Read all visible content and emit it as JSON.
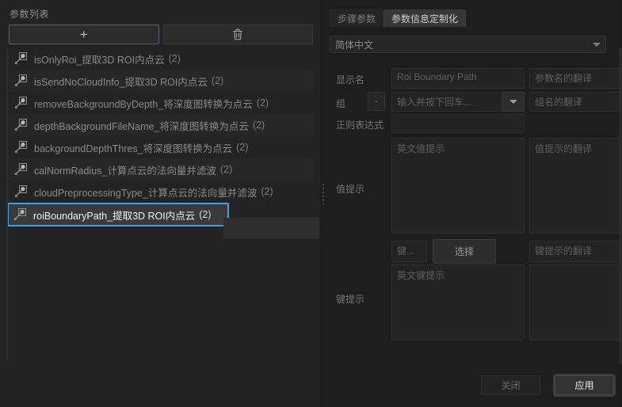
{
  "left_panel": {
    "title": "参数列表",
    "toolbar": {
      "add_label": "+",
      "add_icon": "plus-icon",
      "delete_icon": "trash-icon"
    },
    "items": [
      {
        "label": "isOnlyRoi_提取3D ROI内点云",
        "count": "(2)",
        "selected": false
      },
      {
        "label": "isSendNoCloudInfo_提取3D ROI内点云",
        "count": "(2)",
        "selected": false
      },
      {
        "label": "removeBackgroundByDepth_将深度图转换为点云",
        "count": "(2)",
        "selected": false
      },
      {
        "label": "depthBackgroundFileName_将深度图转换为点云",
        "count": "(2)",
        "selected": false
      },
      {
        "label": "backgroundDepthThres_将深度图转换为点云",
        "count": "(2)",
        "selected": false
      },
      {
        "label": "calNormRadius_计算点云的法向量并滤波",
        "count": "(2)",
        "selected": false
      },
      {
        "label": "cloudPreprocessingType_计算点云的法向量并滤波",
        "count": "(2)",
        "selected": false
      },
      {
        "label": "roiBoundaryPath_提取3D ROI内点云",
        "count": "(2)",
        "selected": true
      }
    ]
  },
  "right_panel": {
    "tabs": [
      {
        "label": "步骤参数",
        "active": false
      },
      {
        "label": "参数信息定制化",
        "active": true
      }
    ],
    "language_select": {
      "value": "简体中文"
    },
    "fields": {
      "display_name_label": "显示名",
      "display_name_value": "Roi Boundary Path",
      "param_name_translation_placeholder": "参数名的翻译",
      "group_label": "组",
      "group_minus": "-",
      "group_placeholder": "输入并按下回车...",
      "group_translation_placeholder": "组名的翻译",
      "regex_label": "正则表达式",
      "regex_value": "",
      "value_hint_label": "值提示",
      "value_hint_en_placeholder": "英文值提示",
      "value_hint_translation_placeholder": "值提示的翻译",
      "key_label_placeholder": "键...",
      "select_button": "选择",
      "key_hint_translation_placeholder": "键提示的翻译",
      "key_hint_en_placeholder": "英文键提示",
      "key_hint_label": "键提示"
    },
    "footer": {
      "close_label": "关闭",
      "apply_label": "应用"
    }
  },
  "colors": {
    "selection_border": "#3da2e8",
    "panel_background": "#232323",
    "app_background": "#1e1e1e",
    "selected_row": "#3a3a3a"
  }
}
